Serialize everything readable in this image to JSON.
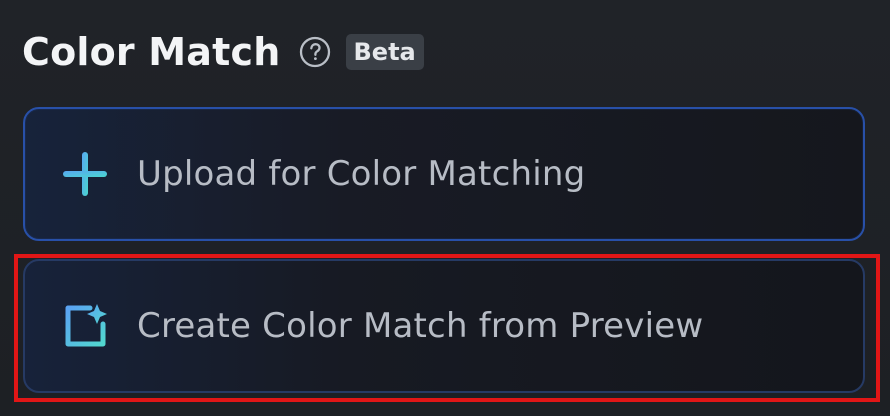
{
  "section": {
    "title": "Color Match",
    "help_icon": "help-circle-icon",
    "badge": "Beta"
  },
  "actions": [
    {
      "label": "Upload for Color Matching",
      "icon": "plus-icon"
    },
    {
      "label": "Create Color Match from Preview",
      "icon": "sparkle-frame-icon"
    }
  ],
  "colors": {
    "background": "#1f2226",
    "title": "#f3f4f6",
    "label": "#b7bcc5",
    "badge_background": "#3a3f46",
    "upload_border": "#2850a8",
    "create_border": "#263a64",
    "highlight": "#e11616",
    "icon_gradient_start": "#58a7f2",
    "icon_gradient_end": "#4ad6ce"
  }
}
